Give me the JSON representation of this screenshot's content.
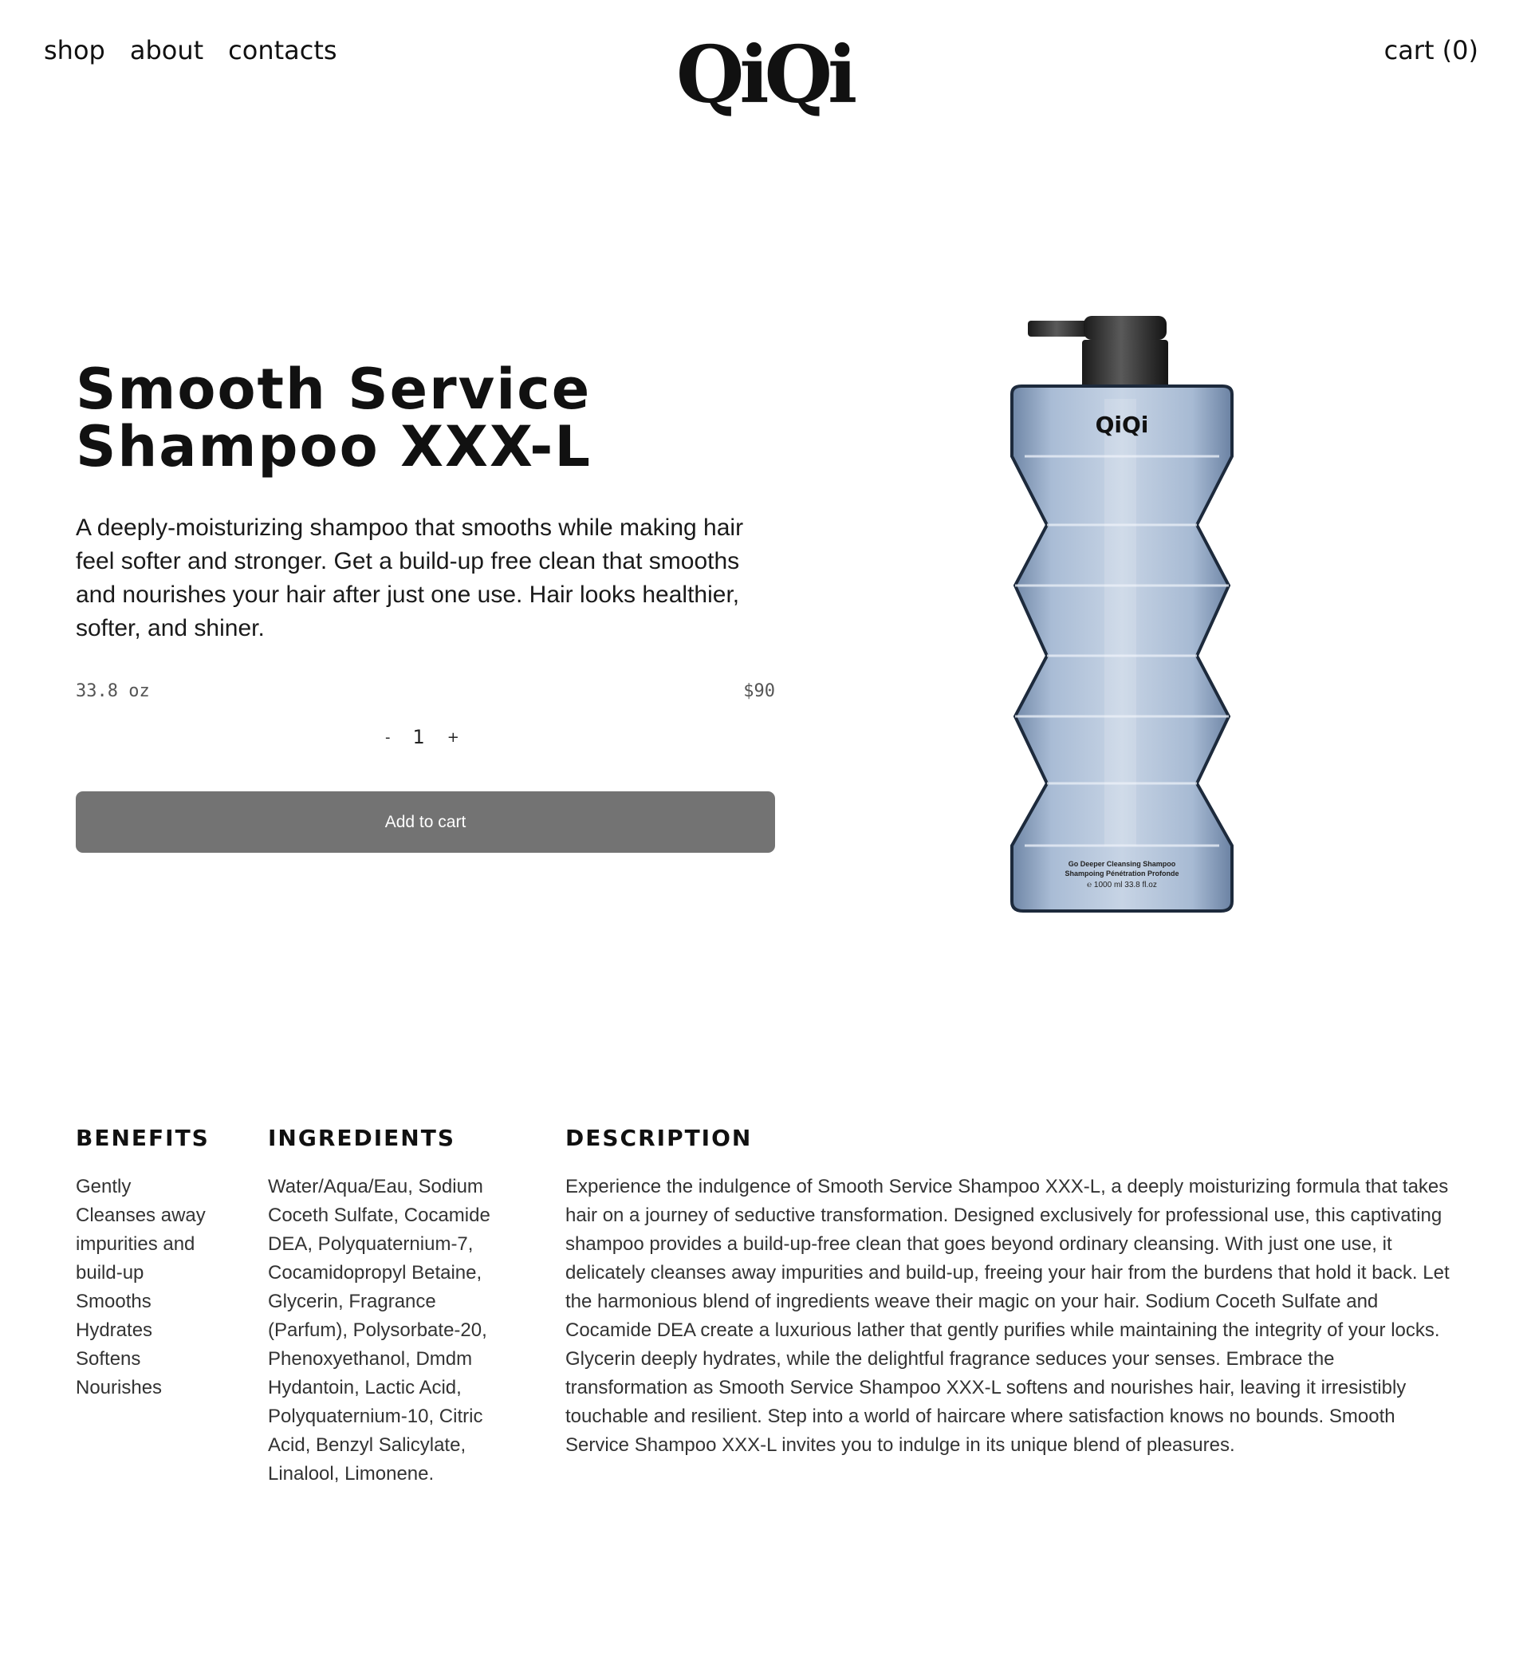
{
  "header": {
    "nav": [
      "shop",
      "about",
      "contacts"
    ],
    "logo": "QiQi",
    "cart_label": "cart (0)"
  },
  "product": {
    "title_line1": "Smooth Service",
    "title_line2": "Shampoo XXX-L",
    "lead": "A deeply-moisturizing shampoo that smooths while making hair feel softer and stronger. Get a build-up free clean that smooths and nourishes your hair after just one use. Hair looks healthier, softer, and shiner.",
    "size": "33.8 oz",
    "price": "$90",
    "quantity": "1",
    "decrement": "-",
    "increment": "+",
    "add_to_cart": "Add to cart",
    "bottle_label": {
      "brand": "QiQi",
      "line1": "Go Deeper Cleansing Shampoo",
      "line2": "Shampoing Pénétration Profonde",
      "line3": "℮ 1000 ml 33.8 fl.oz"
    },
    "bottle_color": "#9fb3cd"
  },
  "benefits": {
    "heading": "BENEFITS",
    "lines": [
      "Gently",
      "Cleanses away",
      "impurities and",
      "build-up",
      "Smooths",
      "Hydrates",
      "Softens",
      "Nourishes"
    ]
  },
  "ingredients": {
    "heading": "INGREDIENTS",
    "lines": [
      "Water/Aqua/Eau, Sodium",
      "Coceth Sulfate, Cocamide",
      "DEA, Polyquaternium-7,",
      "Cocamidopropyl Betaine,",
      "Glycerin, Fragrance",
      "(Parfum), Polysorbate-20,",
      "Phenoxyethanol, Dmdm",
      "Hydantoin, Lactic Acid,",
      "Polyquaternium-10, Citric",
      "Acid, Benzyl Salicylate,",
      "Linalool, Limonene."
    ]
  },
  "description": {
    "heading": "DESCRIPTION",
    "text": "Experience the indulgence of Smooth Service Shampoo XXX-L, a deeply moisturizing formula that takes hair on a journey of seductive transformation. Designed exclusively for professional use, this captivating shampoo provides a build-up-free clean that goes beyond ordinary cleansing. With just one use, it delicately cleanses away impurities and build-up, freeing your hair from the burdens that hold it back. Let the harmonious blend of ingredients weave their magic on your hair. Sodium Coceth Sulfate and Cocamide DEA create a luxurious lather that gently purifies while maintaining the integrity of your locks. Glycerin deeply hydrates, while the delightful fragrance seduces your senses. Embrace the transformation as Smooth Service Shampoo XXX-L softens and nourishes hair, leaving it irresistibly touchable and resilient. Step into a world of haircare where satisfaction knows no bounds. Smooth Service Shampoo XXX-L invites you to indulge in its unique blend of pleasures."
  }
}
